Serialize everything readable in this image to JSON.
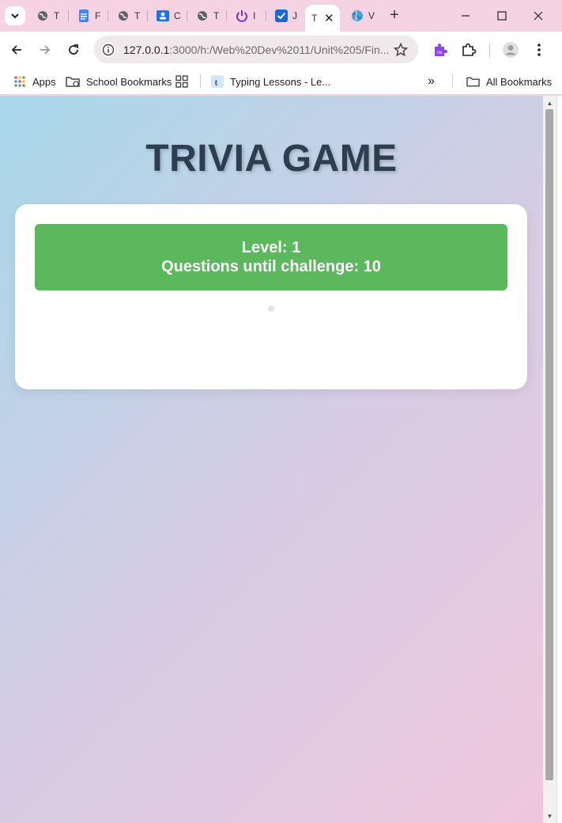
{
  "browser": {
    "tabs": [
      {
        "icon": "globe-icon",
        "title": "T"
      },
      {
        "icon": "docs-icon",
        "title": "F"
      },
      {
        "icon": "globe-icon",
        "title": "T"
      },
      {
        "icon": "classroom-icon",
        "title": "C"
      },
      {
        "icon": "globe-icon",
        "title": "T"
      },
      {
        "icon": "power-icon",
        "title": "I"
      },
      {
        "icon": "checkbox-icon",
        "title": "J"
      },
      {
        "icon": "",
        "title": "T",
        "active": true
      },
      {
        "icon": "globe-color-icon",
        "title": "V"
      }
    ],
    "new_tab_label": "+",
    "url_host": "127.0.0.1",
    "url_rest": ":3000/h:/Web%20Dev%2011/Unit%205/Fin...",
    "bookmarks": {
      "apps": "Apps",
      "school": "School Bookmarks",
      "typing": "Typing Lessons - Le...",
      "all": "All Bookmarks",
      "overflow": "»"
    },
    "colors": {
      "tabstrip": "#f5d3e2",
      "accent": "#5cb85c"
    }
  },
  "page": {
    "title": "TRIVIA GAME",
    "level_line": "Level: 1",
    "challenge_line": "Questions until challenge: 10"
  }
}
